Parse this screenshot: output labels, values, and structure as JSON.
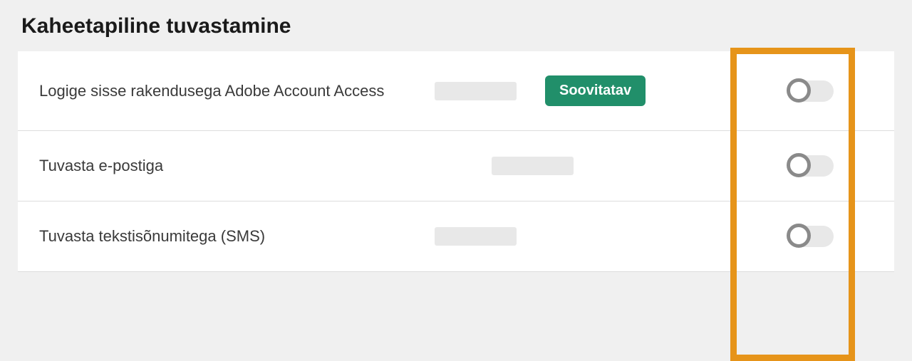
{
  "section": {
    "title": "Kaheetapiline tuvastamine"
  },
  "options": [
    {
      "label": "Logige sisse rakendusega Adobe Account Access",
      "badge": "Soovitatav",
      "hasBadge": true
    },
    {
      "label": "Tuvasta e-postiga",
      "hasBadge": false
    },
    {
      "label": "Tuvasta tekstisõnumitega (SMS)",
      "hasBadge": false
    }
  ],
  "colors": {
    "badgeBg": "#218f6a",
    "highlight": "#e6941a"
  }
}
